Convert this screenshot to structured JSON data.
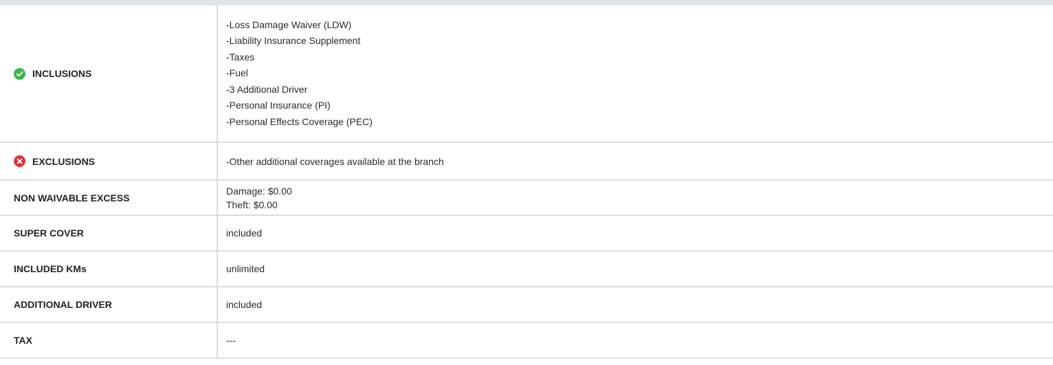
{
  "rows": {
    "inclusions": {
      "label": "INCLUSIONS",
      "icon": "check-circle-icon",
      "items": [
        "-Loss Damage Waiver (LDW)",
        "-Liability Insurance Supplement",
        "-Taxes",
        "-Fuel",
        "-3 Additional Driver",
        "-Personal Insurance (PI)",
        "-Personal Effects Coverage (PEC)"
      ]
    },
    "exclusions": {
      "label": "EXCLUSIONS",
      "icon": "x-circle-icon",
      "items": [
        "-Other additional coverages available at the branch"
      ]
    },
    "non_waivable_excess": {
      "label": "NON WAIVABLE EXCESS",
      "damage": "Damage: $0.00",
      "theft": "Theft: $0.00"
    },
    "super_cover": {
      "label": "SUPER COVER",
      "value": "included"
    },
    "included_kms": {
      "label": "INCLUDED KMs",
      "value": "unlimited"
    },
    "additional_driver": {
      "label": "ADDITIONAL DRIVER",
      "value": "included"
    },
    "tax": {
      "label": "TAX",
      "value": "---"
    }
  },
  "colors": {
    "check": "#3cb54a",
    "cross": "#e0323b",
    "border": "#dcdcdc",
    "topbar": "#dfe3e7"
  }
}
